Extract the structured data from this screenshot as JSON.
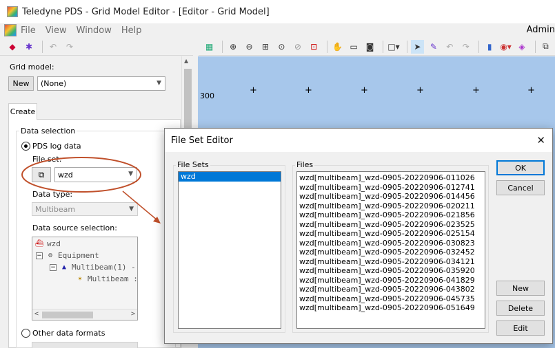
{
  "window": {
    "title": "Teledyne PDS - Grid Model Editor - [Editor - Grid Model]"
  },
  "menu": {
    "items": [
      "File",
      "View",
      "Window",
      "Help"
    ],
    "user": "Admin"
  },
  "left_panel": {
    "grid_model_label": "Grid model:",
    "new_button": "New",
    "grid_model_value": "(None)",
    "tab_label": "Create",
    "data_selection_label": "Data selection",
    "pds_log_data_label": "PDS log data",
    "file_set_label": "File set:",
    "file_set_value": "wzd",
    "data_type_label": "Data type:",
    "data_type_value": "Multibeam",
    "data_source_label": "Data source selection:",
    "tree": {
      "root": "wzd",
      "equipment": "Equipment",
      "multibeam_group": "Multibeam(1) -",
      "multibeam_item": "Multibeam :"
    },
    "other_formats_label": "Other data formats"
  },
  "canvas": {
    "y_label": "300",
    "background": "#a7c7eb"
  },
  "dialog": {
    "title": "File Set Editor",
    "file_sets_label": "File Sets",
    "files_label": "Files",
    "file_sets": [
      "wzd"
    ],
    "files": [
      "wzd[multibeam]_wzd-0905-20220906-011026",
      "wzd[multibeam]_wzd-0905-20220906-012741",
      "wzd[multibeam]_wzd-0905-20220906-014456",
      "wzd[multibeam]_wzd-0905-20220906-020211",
      "wzd[multibeam]_wzd-0905-20220906-021856",
      "wzd[multibeam]_wzd-0905-20220906-023525",
      "wzd[multibeam]_wzd-0905-20220906-025154",
      "wzd[multibeam]_wzd-0905-20220906-030823",
      "wzd[multibeam]_wzd-0905-20220906-032452",
      "wzd[multibeam]_wzd-0905-20220906-034121",
      "wzd[multibeam]_wzd-0905-20220906-035920",
      "wzd[multibeam]_wzd-0905-20220906-041829",
      "wzd[multibeam]_wzd-0905-20220906-043802",
      "wzd[multibeam]_wzd-0905-20220906-045735",
      "wzd[multibeam]_wzd-0905-20220906-051649"
    ],
    "buttons": {
      "ok": "OK",
      "cancel": "Cancel",
      "new": "New",
      "delete": "Delete",
      "edit": "Edit"
    }
  },
  "colors": {
    "selection": "#0078d7",
    "annotation": "#c0502b",
    "canvas": "#a7c7eb"
  }
}
